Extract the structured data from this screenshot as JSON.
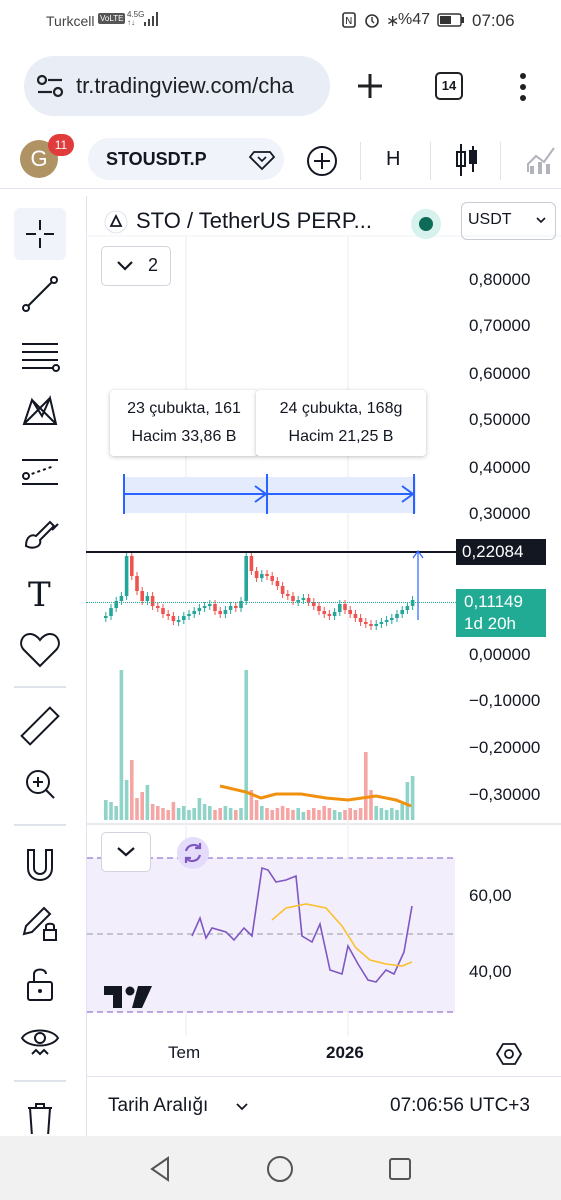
{
  "status": {
    "carrier": "Turkcell",
    "volte": "VoLTE",
    "net_top": "4.5G",
    "net_bottom": "↑↓",
    "battery": "%47",
    "time": "07:06"
  },
  "browser": {
    "url": "tr.tradingview.com/cha",
    "tabs": "14"
  },
  "toolbar": {
    "avatar_letter": "G",
    "notifications": "11",
    "symbol": "STOUSDT.P",
    "interval": "H"
  },
  "chart_header": {
    "title": "STO / TetherUS PERP...",
    "currency": "USDT",
    "indicator_count": "2"
  },
  "price_axis": [
    "0,80000",
    "0,70000",
    "0,60000",
    "0,50000",
    "0,40000",
    "0,30000",
    "0,00000",
    "−0,10000",
    "−0,20000",
    "−0,30000"
  ],
  "current_price": {
    "value": "0,11149",
    "countdown": "1d 20h",
    "color": "#22ab94"
  },
  "line_price": {
    "value": "0,22084"
  },
  "measure": [
    {
      "bars": "23 çubukta, 161",
      "volume": "Hacim 33,86 B"
    },
    {
      "bars": "24 çubukta, 168g",
      "volume": "Hacim 21,25 B"
    }
  ],
  "rsi_axis": [
    "60,00",
    "40,00"
  ],
  "time_axis": {
    "label1": "Tem",
    "label2": "2026"
  },
  "footer": {
    "date_range": "Tarih Aralığı",
    "clock": "07:06:56 UTC+3"
  },
  "colors": {
    "up": "#26a69a",
    "down": "#ef5350",
    "rsi": "#7e57c2",
    "rsi_ma": "#fbc02d",
    "volume_ma": "#f0900c",
    "measure": "#2962ff"
  }
}
